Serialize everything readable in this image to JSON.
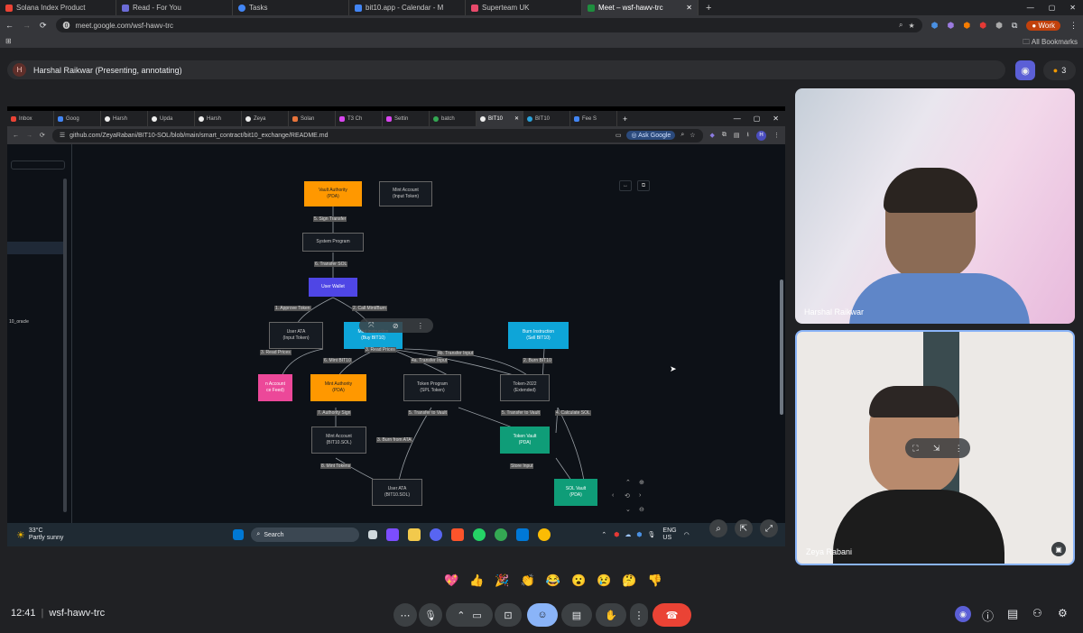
{
  "browser": {
    "tabs": [
      {
        "label": "Solana Index Product",
        "color": "#ea4335"
      },
      {
        "label": "Read - For You",
        "color": "#6b6bd6"
      },
      {
        "label": "Tasks",
        "color": "#4285f4"
      },
      {
        "label": "bit10.app - Calendar - M",
        "color": "#4285f4"
      },
      {
        "label": "Superteam UK",
        "color": "#e84a6b"
      },
      {
        "label": "Meet – wsf-hawv-trc",
        "color": "#1e8e3e"
      }
    ],
    "new_tab_label": "+",
    "url": "meet.google.com/wsf-hawv-trc",
    "profile_label": "Work",
    "bookmarks_label": "All Bookmarks"
  },
  "presenter": {
    "avatar_letter": "H",
    "label": "Harshal Raikwar (Presenting, annotating)",
    "participants_count": "3"
  },
  "shared_screen": {
    "tabs": [
      "Inbox",
      "Goog",
      "Harsh",
      "Upda",
      "Harsh",
      "Zeya",
      "Solan",
      "T3 Ch",
      "Settin",
      "batch",
      "BIT10",
      "BIT10",
      "Fee S"
    ],
    "url": "github.com/ZeyaRabani/BIT10-SOL/blob/main/smart_contract/bit10_exchange/README.md",
    "ask_google": "Ask Google",
    "profile_letter": "H",
    "sidebar_text": "10_oracle",
    "diagram": {
      "nodes": {
        "vault_authority": [
          "Vault Authority",
          "(PDA)"
        ],
        "mint_account_input": [
          "Mint Account",
          "(Input Token)"
        ],
        "system_program": [
          "System Program"
        ],
        "user_wallet": [
          "User Wallet"
        ],
        "user_ata_input": [
          "User ATA",
          "(Input Token)"
        ],
        "mint_instruction": [
          "Mint Instruction",
          "(Buy BIT10)"
        ],
        "burn_instruction": [
          "Burn Instruction",
          "(Sell BIT10)"
        ],
        "price_feed": [
          "n Account",
          "ce Feed)"
        ],
        "mint_authority": [
          "Mint Authority",
          "(PDA)"
        ],
        "token_program": [
          "Token Program",
          "(SPL Token)"
        ],
        "token_2022": [
          "Token-2022",
          "(Extended)"
        ],
        "mint_account_bit10": [
          "Mint Account",
          "(BIT10.SOL)"
        ],
        "token_vault": [
          "Token Vault",
          "(PDA)"
        ],
        "user_ata_bit10": [
          "User ATA",
          "(BIT10.SOL)"
        ],
        "sol_vault": [
          "SOL Vault",
          "(PDA)"
        ]
      },
      "edges": {
        "sign_transfer": "5. Sign Transfer",
        "transfer_sol": "6. Transfer SOL",
        "approve_token": "1. Approve Token",
        "call_mint_burn": "2. Call Mint/Burn",
        "read_prices_1": "3. Read Prices",
        "read_prices_2": "3. Read Prices",
        "mint_bit10": "6. Mint BIT10",
        "transfer_input_4b": "4b. Transfer Input",
        "transfer_input_4a": "4a. Transfer Input",
        "burn_bit10": "2. Burn BIT10",
        "authority_sign": "7. Authority Sign",
        "transfer_to_vault_1": "5. Transfer to Vault",
        "transfer_to_vault_2": "5. Transfer to Vault",
        "calculate_sol": "4. Calculate SOL",
        "burn_from_ata": "3. Burn from ATA",
        "mint_tokens": "8. Mint Tokens",
        "store_input": "Store Input"
      }
    },
    "taskbar": {
      "temperature": "33°C",
      "weather": "Partly sunny",
      "search_placeholder": "Search",
      "lang": "ENG",
      "region": "US"
    }
  },
  "participants": [
    {
      "name": "Harshal Raikwar"
    },
    {
      "name": "Zeya Rabani"
    }
  ],
  "reactions": [
    "💖",
    "👍",
    "🎉",
    "👏",
    "😂",
    "😮",
    "😢",
    "🤔",
    "👎"
  ],
  "footer": {
    "time": "12:41",
    "separator": "|",
    "meeting_code": "wsf-hawv-trc"
  }
}
